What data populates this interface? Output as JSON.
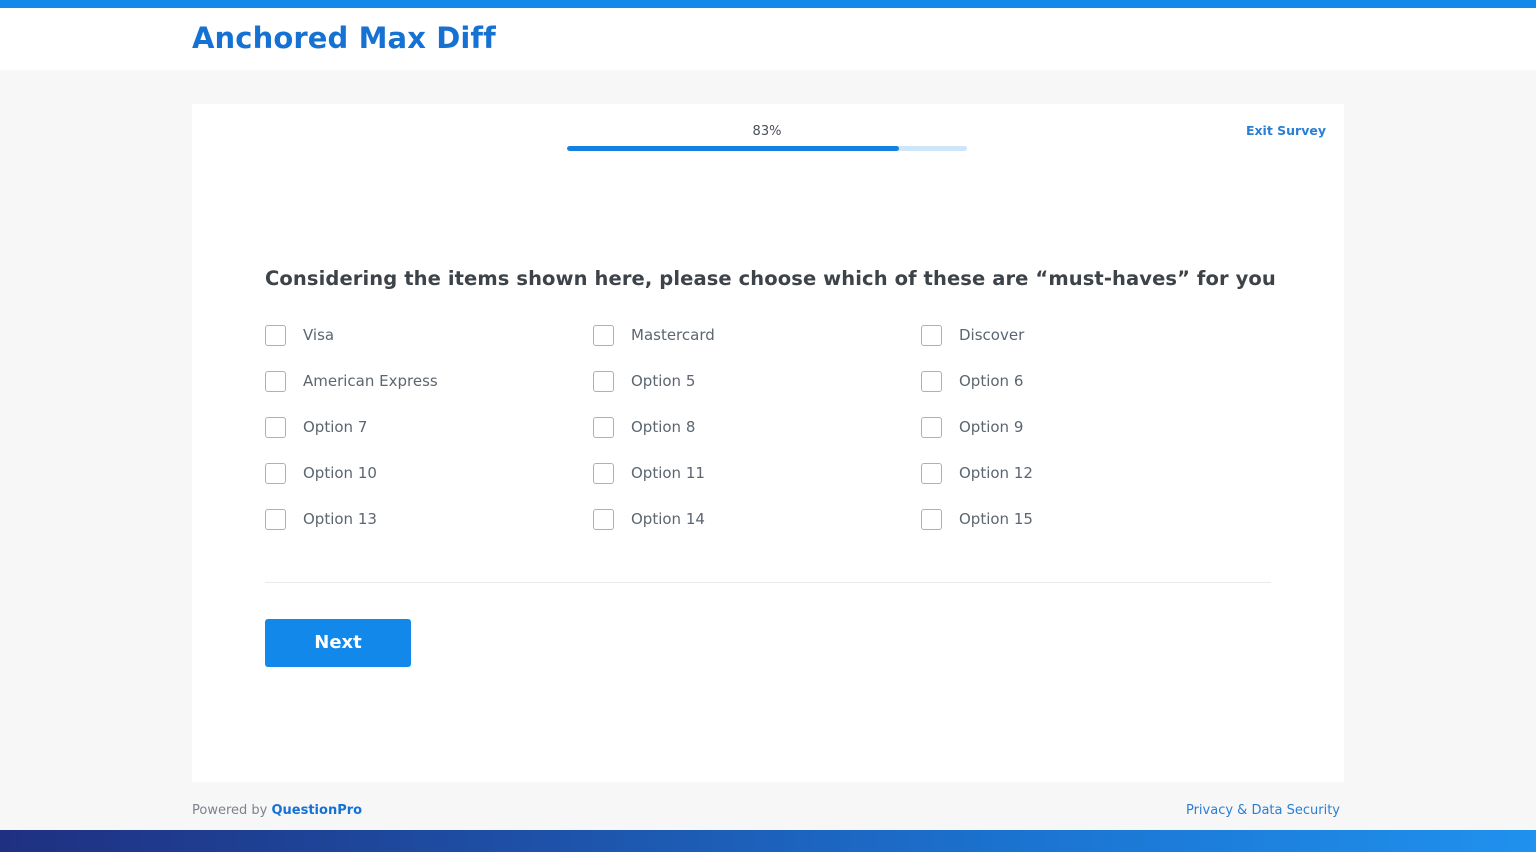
{
  "theme": {
    "accent": "#1289ea",
    "link": "#2a7fd4",
    "title_color": "#1572d3",
    "text_color": "#5c6670",
    "page_bg": "#f7f7f8",
    "card_bg": "#ffffff",
    "progress_track": "#cfe5fa",
    "progress_fill": "#1580e0",
    "checkbox_border": "#8cb8e4",
    "divider": "#e9eaec",
    "footer_gradient_start": "#1f3081",
    "footer_gradient_end": "#2091ee"
  },
  "header": {
    "title": "Anchored Max Diff"
  },
  "survey": {
    "progress": {
      "percent_label": "83%",
      "percent_value": 83
    },
    "exit_label": "Exit Survey",
    "question": "Considering the items shown here, please choose which of these are “must-haves” for you",
    "options": [
      {
        "label": "Visa",
        "checked": false
      },
      {
        "label": "Mastercard",
        "checked": false
      },
      {
        "label": "Discover",
        "checked": false
      },
      {
        "label": "American Express",
        "checked": false
      },
      {
        "label": "Option 5",
        "checked": false
      },
      {
        "label": "Option 6",
        "checked": false
      },
      {
        "label": "Option 7",
        "checked": false
      },
      {
        "label": "Option 8",
        "checked": false
      },
      {
        "label": "Option 9",
        "checked": false
      },
      {
        "label": "Option 10",
        "checked": false
      },
      {
        "label": "Option 11",
        "checked": false
      },
      {
        "label": "Option 12",
        "checked": false
      },
      {
        "label": "Option 13",
        "checked": false
      },
      {
        "label": "Option 14",
        "checked": false
      },
      {
        "label": "Option 15",
        "checked": false
      }
    ],
    "next_label": "Next"
  },
  "footer": {
    "powered_by_prefix": "Powered by ",
    "brand": "QuestionPro",
    "privacy_label": "Privacy & Data Security"
  }
}
